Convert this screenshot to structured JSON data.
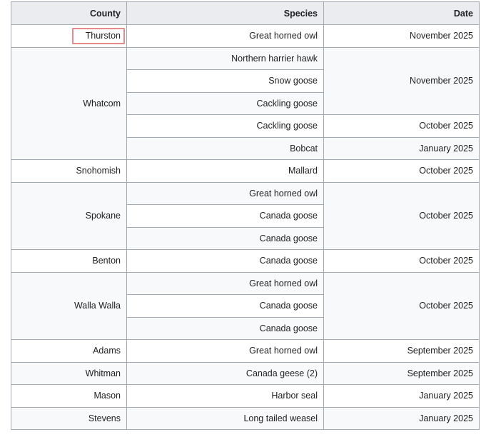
{
  "headers": {
    "county": "County",
    "species": "Species",
    "date": "Date"
  },
  "rows": [
    {
      "county": "Thurston",
      "species": [
        "Great horned owl"
      ],
      "date": "November 2025"
    },
    {
      "county": "Whatcom",
      "species": [
        "Northern harrier hawk",
        "Snow goose",
        "Cackling goose",
        "Cackling goose",
        "Bobcat"
      ],
      "dates": [
        "November 2025",
        "October 2025",
        "January 2025"
      ]
    },
    {
      "county": "Snohomish",
      "species": [
        "Mallard"
      ],
      "date": "October 2025"
    },
    {
      "county": "Spokane",
      "species": [
        "Great horned owl",
        "Canada goose",
        "Canada goose"
      ],
      "date": "October 2025"
    },
    {
      "county": "Benton",
      "species": [
        "Canada goose"
      ],
      "date": "October 2025"
    },
    {
      "county": "Walla Walla",
      "species": [
        "Great horned owl",
        "Canada goose",
        "Canada goose"
      ],
      "date": "October 2025"
    },
    {
      "county": "Adams",
      "species": [
        "Great horned owl"
      ],
      "date": "September 2025"
    },
    {
      "county": "Whitman",
      "species": [
        "Canada geese (2)"
      ],
      "date": "September 2025"
    },
    {
      "county": "Mason",
      "species": [
        "Harbor seal"
      ],
      "date": "January 2025"
    },
    {
      "county": "Stevens",
      "species": [
        "Long tailed weasel"
      ],
      "date": "January 2025"
    }
  ],
  "highlight_color": "#e8898b"
}
